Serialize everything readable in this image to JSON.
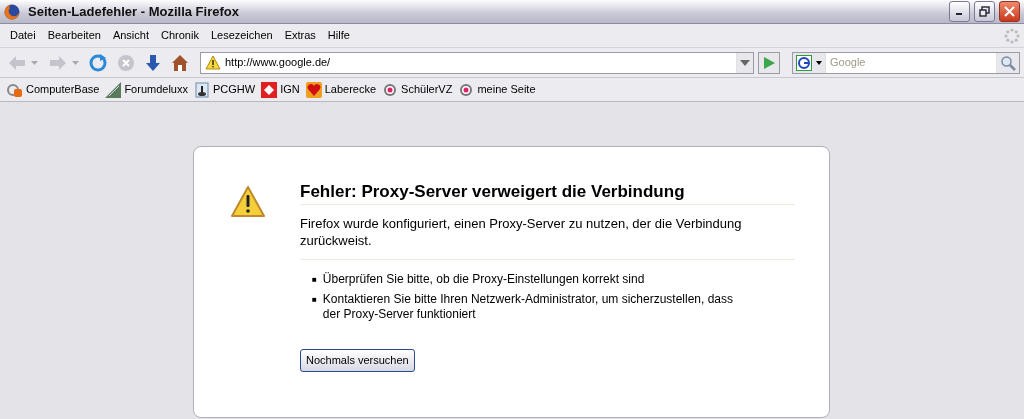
{
  "window": {
    "title": "Seiten-Ladefehler - Mozilla Firefox"
  },
  "menu": [
    "Datei",
    "Bearbeiten",
    "Ansicht",
    "Chronik",
    "Lesezeichen",
    "Extras",
    "Hilfe"
  ],
  "nav_buttons": [
    {
      "kind": "back",
      "disabled": true
    },
    {
      "kind": "forward",
      "disabled": true
    },
    {
      "kind": "reload",
      "disabled": false
    },
    {
      "kind": "stop",
      "disabled": true
    },
    {
      "kind": "download",
      "disabled": false
    },
    {
      "kind": "home",
      "disabled": false
    }
  ],
  "address": {
    "value": "http://www.google.de/"
  },
  "search": {
    "placeholder": "Google"
  },
  "bookmarks": [
    {
      "label": "ComputerBase",
      "kind": "cb"
    },
    {
      "label": "Forumdeluxx",
      "kind": "stripes"
    },
    {
      "label": "PCGHW",
      "kind": "joystick"
    },
    {
      "label": "IGN",
      "kind": "ign"
    },
    {
      "label": "Laberecke",
      "kind": "hearts"
    },
    {
      "label": "SchülerVZ",
      "kind": "flower"
    },
    {
      "label": "meine Seite",
      "kind": "flower"
    }
  ],
  "error": {
    "title": "Fehler: Proxy-Server verweigert die Verbindung",
    "description": "Firefox wurde konfiguriert, einen Proxy-Server zu nutzen, der die Verbindung zurückweist.",
    "hints": [
      {
        "bullet": "■",
        "text": "Überprüfen Sie bitte, ob die Proxy-Einstellungen korrekt sind"
      },
      {
        "bullet": "■",
        "text": "Kontaktieren Sie bitte Ihren Netzwerk-Administrator, um sicherzustellen, dass der Proxy-Server funktioniert"
      }
    ],
    "button": "Nochmals versuchen"
  }
}
